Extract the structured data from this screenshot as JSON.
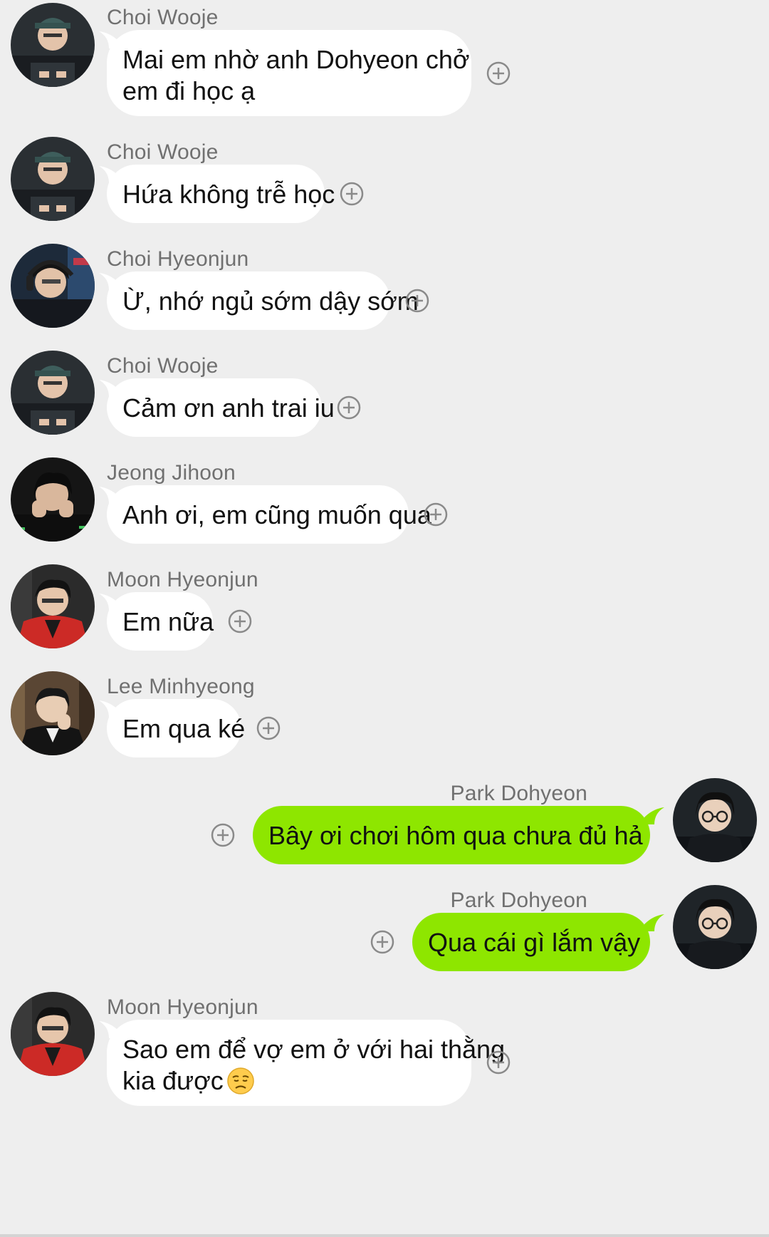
{
  "conversation": {
    "messages": [
      {
        "sender": "Choi Wooje",
        "text": "Mai em nhờ anh Dohyeon chở",
        "text_line2": "em đi học ạ",
        "direction": "incoming",
        "avatar": "choi-wooje-avatar"
      },
      {
        "sender": "Choi Wooje",
        "text": "Hứa không trễ học",
        "direction": "incoming",
        "avatar": "choi-wooje-avatar"
      },
      {
        "sender": "Choi Hyeonjun",
        "text": "Ừ, nhớ ngủ sớm dậy sớm",
        "direction": "incoming",
        "avatar": "choi-hyeonjun-avatar"
      },
      {
        "sender": "Choi Wooje",
        "text": "Cảm ơn anh trai iu",
        "direction": "incoming",
        "avatar": "choi-wooje-avatar"
      },
      {
        "sender": "Jeong Jihoon",
        "text": "Anh ơi, em cũng muốn qua",
        "direction": "incoming",
        "avatar": "jeong-jihoon-avatar"
      },
      {
        "sender": "Moon Hyeonjun",
        "text": "Em nữa",
        "direction": "incoming",
        "avatar": "moon-hyeonjun-avatar"
      },
      {
        "sender": "Lee Minhyeong",
        "text": "Em qua ké",
        "direction": "incoming",
        "avatar": "lee-minhyeong-avatar"
      },
      {
        "sender": "Park Dohyeon",
        "text": "Bây ơi chơi hôm qua chưa đủ hả",
        "direction": "outgoing",
        "avatar": "park-dohyeon-avatar"
      },
      {
        "sender": "Park Dohyeon",
        "text": "Qua cái gì lắm vậy",
        "direction": "outgoing",
        "avatar": "park-dohyeon-avatar"
      },
      {
        "sender": "Moon Hyeonjun",
        "text": "Sao em để vợ em ở với hai thằng",
        "text_line2": "kia được",
        "emoji": "disappointed-face-emoji",
        "direction": "incoming",
        "avatar": "moon-hyeonjun-avatar"
      }
    ]
  },
  "icons": {
    "reaction_button": "plus-circle-icon"
  },
  "colors": {
    "background": "#eeeeee",
    "incoming_bubble": "#ffffff",
    "outgoing_bubble": "#8ee600",
    "sender_name": "#707070",
    "message_text": "#111111"
  }
}
